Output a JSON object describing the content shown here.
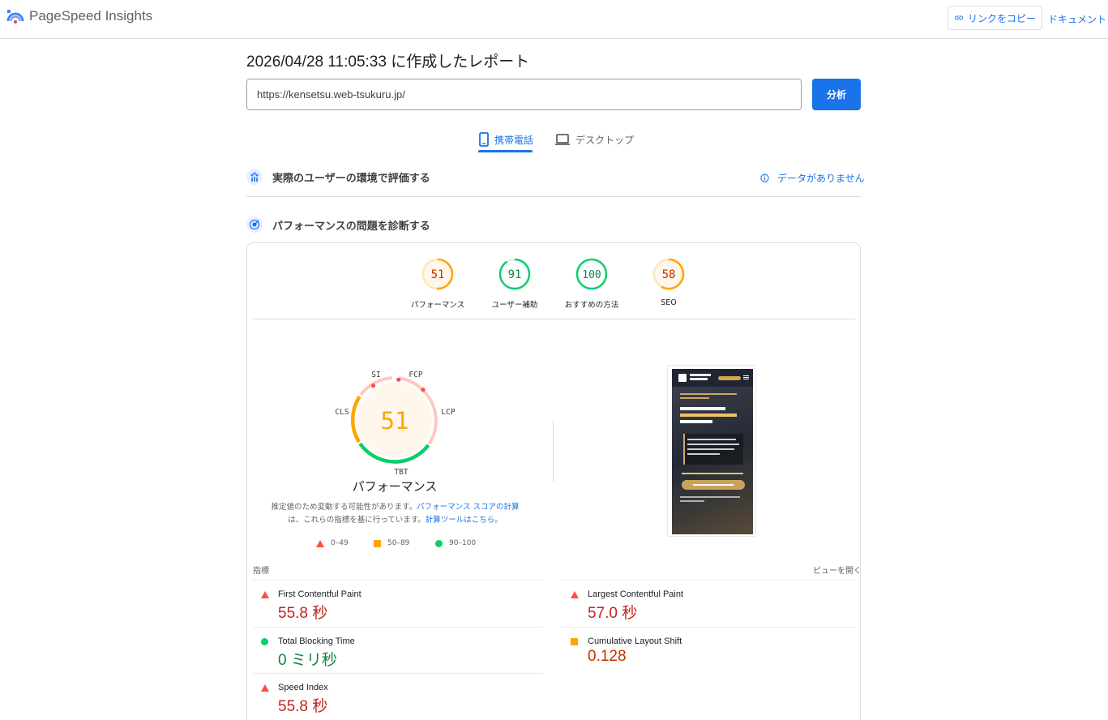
{
  "app": {
    "title": "PageSpeed Insights",
    "copy_link": "リンクをコピー",
    "docs": "ドキュメント"
  },
  "report": {
    "title": "2026/04/28 11:05:33 に作成したレポート",
    "url": "https://kensetsu.web-tsukuru.jp/",
    "analyze": "分析"
  },
  "tabs": [
    {
      "label": "携帯電話",
      "active": true
    },
    {
      "label": "デスクトップ",
      "active": false
    }
  ],
  "field_section": {
    "title": "実際のユーザーの環境で評価する",
    "no_data": "データがありません"
  },
  "lab_section": {
    "title": "パフォーマンスの問題を診断する"
  },
  "categories": [
    {
      "score": "51",
      "label": "パフォーマンス",
      "status": "average"
    },
    {
      "score": "91",
      "label": "ユーザー補助",
      "status": "pass"
    },
    {
      "score": "100",
      "label": "おすすめの方法",
      "status": "pass"
    },
    {
      "score": "58",
      "label": "SEO",
      "status": "average"
    }
  ],
  "performance": {
    "score": "51",
    "label": "パフォーマンス",
    "segments": {
      "si": "SI",
      "fcp": "FCP",
      "lcp": "LCP",
      "tbt": "TBT",
      "cls": "CLS"
    },
    "disclaimer_1": "推定値のため変動する可能性があります。",
    "disclaimer_link_1": "パフォーマンス スコアの計算",
    "disclaimer_2": "は、これらの指標を基に行っています。",
    "disclaimer_link_2": "計算ツールはこちら。"
  },
  "legend": [
    {
      "range": "0–49",
      "kind": "fail"
    },
    {
      "range": "50–89",
      "kind": "average"
    },
    {
      "range": "90–100",
      "kind": "pass"
    }
  ],
  "metrics": {
    "heading": "指標",
    "expand": "ビューを開く",
    "items": [
      {
        "name": "First Contentful Paint",
        "value": "55.8 秒",
        "status": "fail"
      },
      {
        "name": "Largest Contentful Paint",
        "value": "57.0 秒",
        "status": "fail"
      },
      {
        "name": "Total Blocking Time",
        "value": "0 ミリ秒",
        "status": "pass"
      },
      {
        "name": "Cumulative Layout Shift",
        "value": "0.128",
        "status": "average"
      },
      {
        "name": "Speed Index",
        "value": "55.8 秒",
        "status": "fail"
      }
    ]
  },
  "colors": {
    "accent": "#1a73e8",
    "fail": "#c5221f",
    "fail_mark": "#ff4e42",
    "average": "#c33300",
    "average_mark": "#ffa400",
    "pass": "#0d8a3b",
    "pass_mark": "#0cce6b"
  }
}
